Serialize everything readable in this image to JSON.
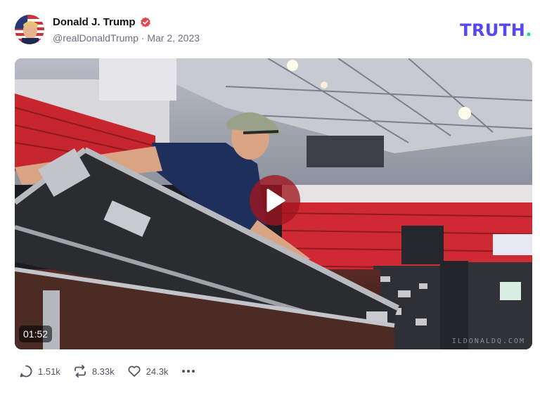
{
  "post": {
    "author_name": "Donald J. Trump",
    "handle": "@realDonaldTrump",
    "separator": "·",
    "date": "Mar 2, 2023",
    "verified_icon": "verified-badge-icon",
    "verified_color": "#e5484d"
  },
  "brand": {
    "logo_text": "TRUTH",
    "logo_dot": ".",
    "primary_color": "#5448ee",
    "accent_color": "#12d6a5"
  },
  "media": {
    "duration": "01:52",
    "watermark": "ILDONALDQ.COM",
    "play_icon": "play-icon"
  },
  "actions": {
    "replies": "1.51k",
    "retruths": "8.33k",
    "likes": "24.3k",
    "reply_icon": "reply-icon",
    "retruth_icon": "retruth-icon",
    "like_icon": "heart-icon",
    "more_icon": "more-icon"
  }
}
